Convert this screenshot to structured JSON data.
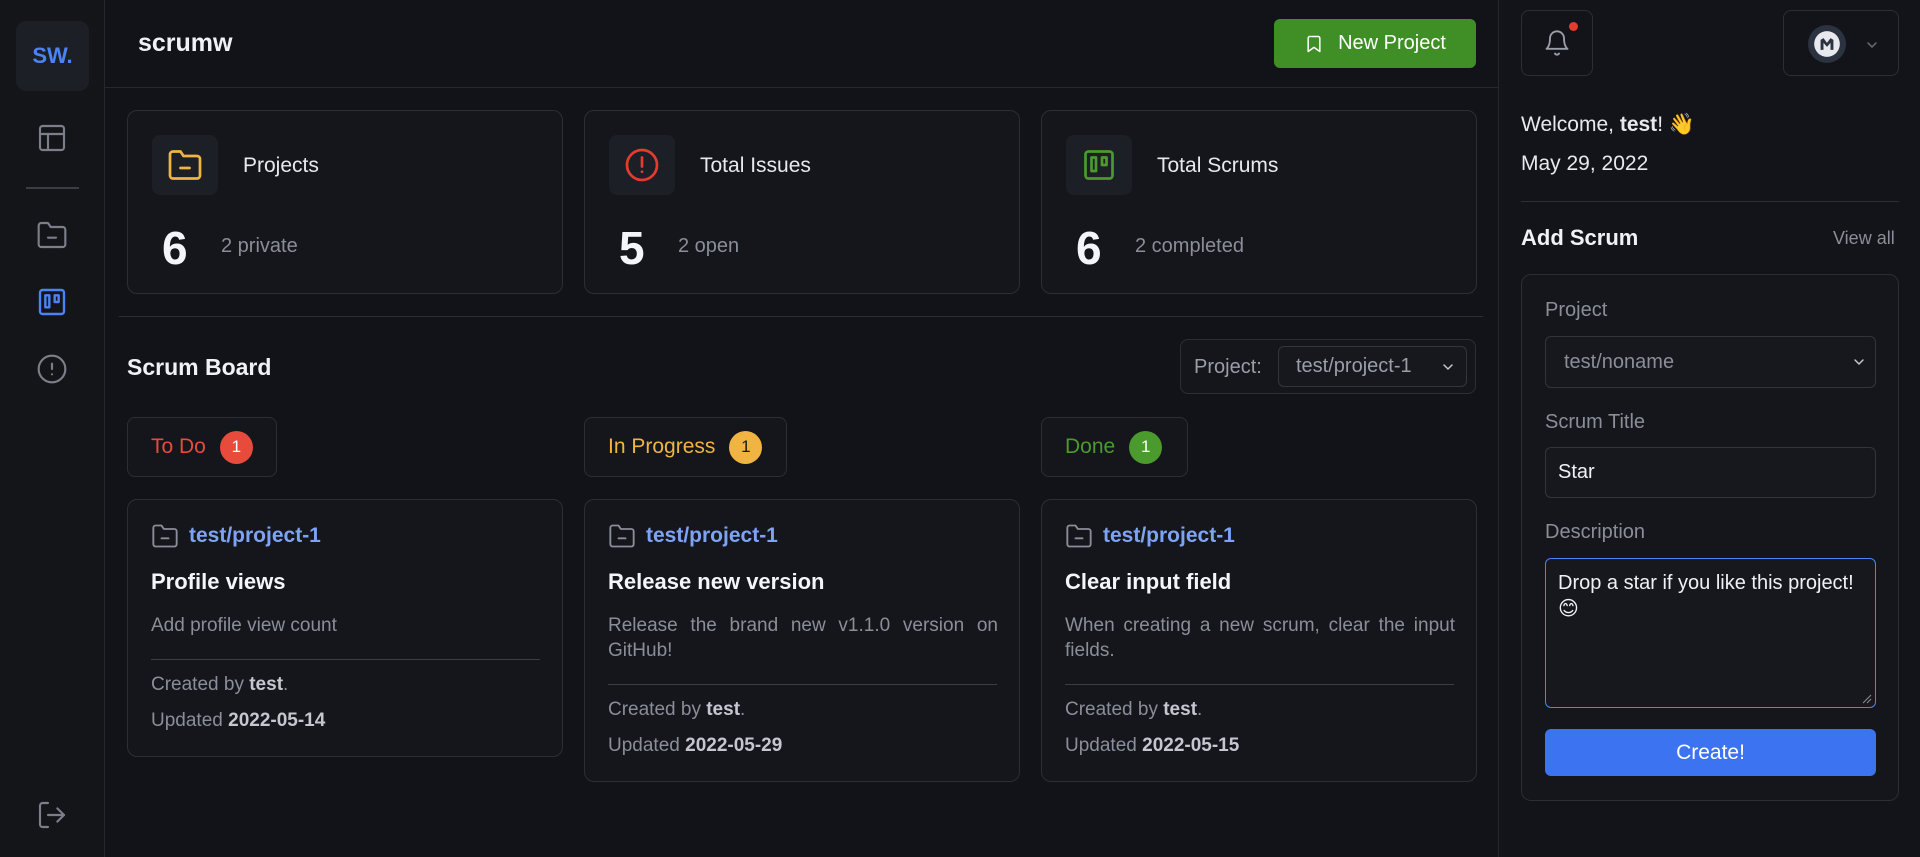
{
  "sidebar": {
    "logo": "SW.",
    "items": [
      {
        "name": "dashboard",
        "icon": "layout-icon"
      },
      {
        "name": "projects",
        "icon": "folder-minus-icon"
      },
      {
        "name": "scrums",
        "icon": "trello-icon"
      },
      {
        "name": "issues",
        "icon": "alert-circle-icon"
      },
      {
        "name": "logout",
        "icon": "logout-icon"
      }
    ]
  },
  "header": {
    "title": "scrumw",
    "new_project_label": "New Project"
  },
  "stats": [
    {
      "label": "Projects",
      "value": "6",
      "sub": "2 private",
      "color": "#f0b443"
    },
    {
      "label": "Total Issues",
      "value": "5",
      "sub": "2 open",
      "color": "#e33b2e"
    },
    {
      "label": "Total Scrums",
      "value": "6",
      "sub": "2 completed",
      "color": "#4a9a2e"
    }
  ],
  "board": {
    "title": "Scrum Board",
    "filter_label": "Project:",
    "filter_value": "test/project-1",
    "columns": [
      {
        "label": "To Do",
        "count": "1",
        "color": "#e84a3c"
      },
      {
        "label": "In Progress",
        "count": "1",
        "color": "#f0b443"
      },
      {
        "label": "Done",
        "count": "1",
        "color": "#4a9a2e"
      }
    ],
    "cards": [
      {
        "project": "test/project-1",
        "title": "Profile views",
        "desc": "Add profile view count",
        "created_prefix": "Created by",
        "created_by": "test",
        "updated_prefix": "Updated",
        "updated": "2022-05-14"
      },
      {
        "project": "test/project-1",
        "title": "Release new version",
        "desc": "Release the brand new v1.1.0 version on GitHub!",
        "created_prefix": "Created by",
        "created_by": "test",
        "updated_prefix": "Updated",
        "updated": "2022-05-29"
      },
      {
        "project": "test/project-1",
        "title": "Clear input field",
        "desc": "When creating a new scrum, clear the input fields.",
        "created_prefix": "Created by",
        "created_by": "test",
        "updated_prefix": "Updated",
        "updated": "2022-05-15"
      }
    ]
  },
  "right": {
    "welcome_prefix": "Welcome,",
    "user": "test",
    "welcome_suffix": "! 👋",
    "date": "May 29, 2022",
    "add_scrum_title": "Add Scrum",
    "view_all": "View all",
    "form": {
      "project_label": "Project",
      "project_value": "test/noname",
      "title_label": "Scrum Title",
      "title_value": "Star",
      "desc_label": "Description",
      "desc_value": "Drop a star if you like this project!  😊",
      "submit": "Create!"
    }
  }
}
